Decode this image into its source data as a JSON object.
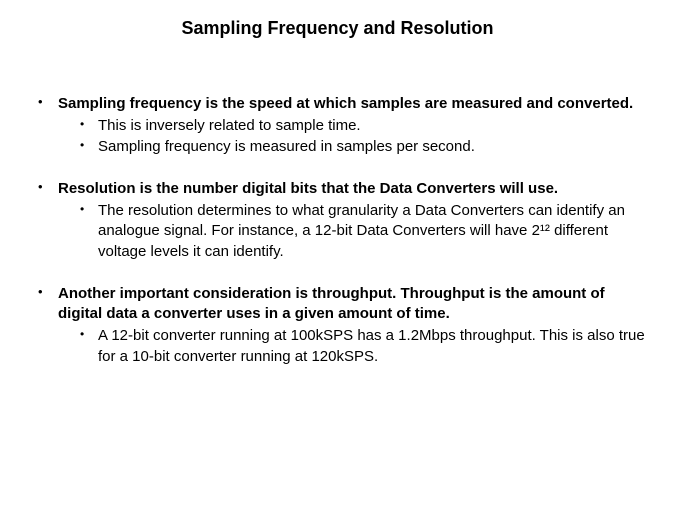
{
  "title": "Sampling Frequency and Resolution",
  "bullets": [
    {
      "text": "Sampling frequency is the speed at which samples are measured and converted.",
      "sub": [
        "This is inversely related to sample time.",
        "Sampling frequency is measured in samples per second."
      ]
    },
    {
      "text": "Resolution is the number digital bits that the Data Converters will use.",
      "sub": [
        "The resolution determines to what granularity a Data Converters can identify an analogue signal. For instance, a 12-bit Data Converters will have 2¹² different voltage levels it can identify."
      ]
    },
    {
      "text": "Another important consideration is throughput. Throughput is the amount of digital data a converter uses in a given amount of time.",
      "sub": [
        "A 12-bit converter running at 100kSPS has a 1.2Mbps throughput. This is also true for a 10-bit converter running at 120kSPS."
      ]
    }
  ]
}
